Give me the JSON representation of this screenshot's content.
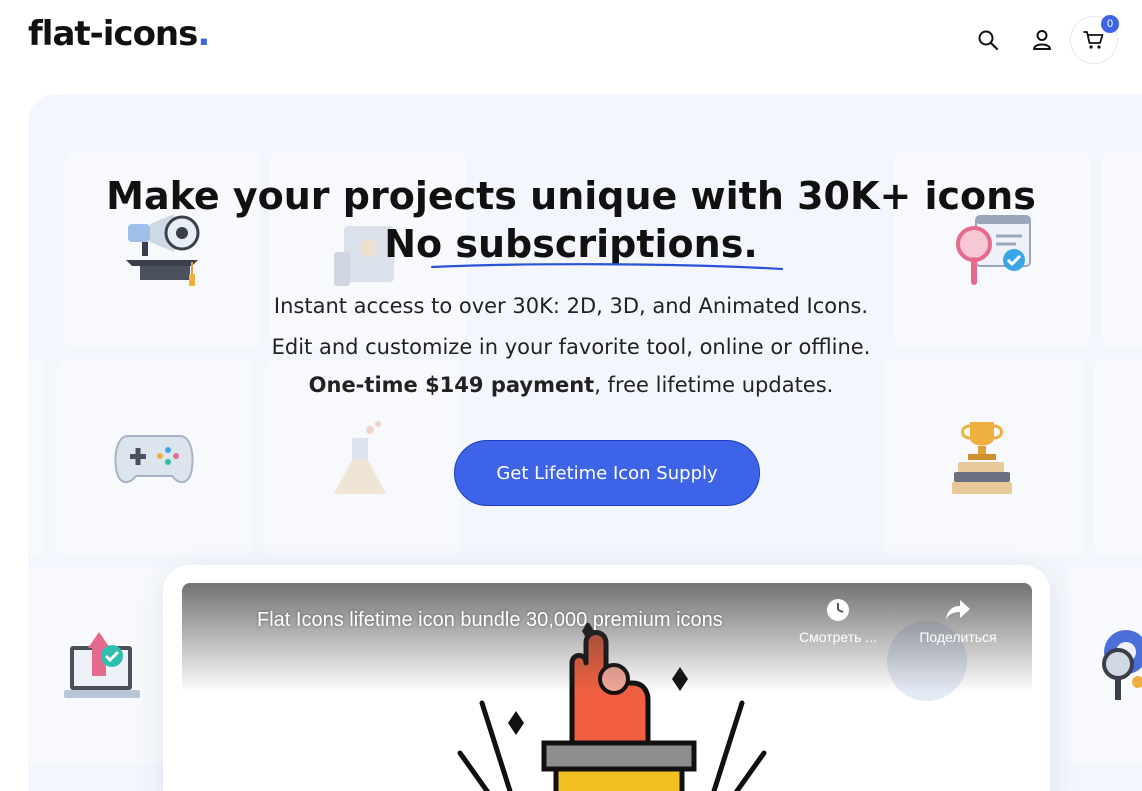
{
  "header": {
    "logo_text": "flat-icons",
    "logo_dot": ".",
    "cart_count": "0",
    "icons": [
      "search-icon",
      "user-icon",
      "cart-icon"
    ]
  },
  "hero": {
    "title_line1": "Make your projects unique with 30K+ icons",
    "title_line2": "No subscriptions.",
    "sub_line1": "Instant access to over 30K: 2D, 3D, and Animated Icons.",
    "sub_line2": "Edit and customize in your favorite tool, online or offline.",
    "sub_line3_bold": "One-time $149 payment",
    "sub_line3_rest": ", free lifetime updates.",
    "cta_label": "Get Lifetime Icon Supply"
  },
  "video": {
    "title": "Flat Icons lifetime icon bundle 30,000 premium icons",
    "watch_later": "Смотреть ...",
    "share": "Поделиться"
  },
  "colors": {
    "accent": "#3d63e8",
    "hero_bg": "#f3f6fc",
    "text": "#111111"
  }
}
